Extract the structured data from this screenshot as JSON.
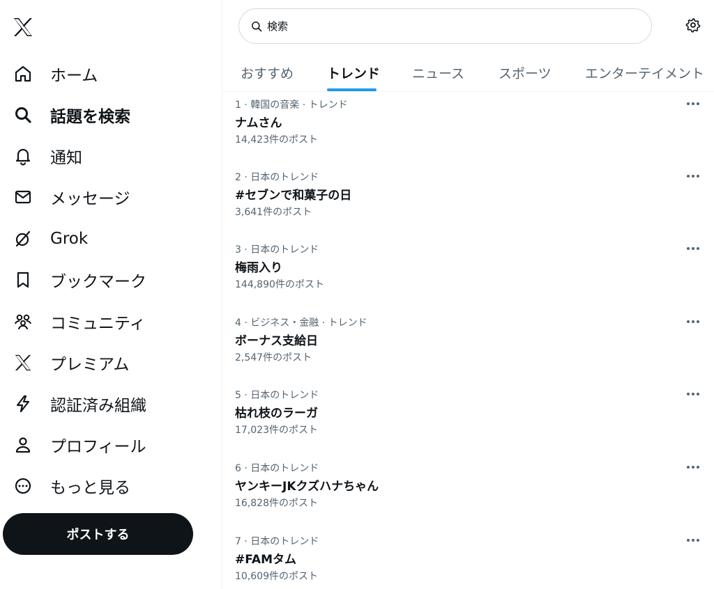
{
  "sidebar": {
    "logo_icon": "x-logo-icon",
    "items": [
      {
        "label": "ホーム",
        "icon": "home-icon"
      },
      {
        "label": "話題を検索",
        "icon": "search-icon",
        "active": true
      },
      {
        "label": "通知",
        "icon": "bell-icon"
      },
      {
        "label": "メッセージ",
        "icon": "mail-icon"
      },
      {
        "label": "Grok",
        "icon": "grok-icon"
      },
      {
        "label": "ブックマーク",
        "icon": "bookmark-icon"
      },
      {
        "label": "コミュニティ",
        "icon": "communities-icon"
      },
      {
        "label": "プレミアム",
        "icon": "x-premium-icon"
      },
      {
        "label": "認証済み組織",
        "icon": "lightning-icon"
      },
      {
        "label": "プロフィール",
        "icon": "profile-icon"
      },
      {
        "label": "もっと見る",
        "icon": "more-circle-icon"
      }
    ],
    "post_button_label": "ポストする"
  },
  "search": {
    "value": "",
    "placeholder": "検索",
    "icon": "search-icon"
  },
  "settings_icon": "gear-icon",
  "tabs": [
    {
      "label": "おすすめ"
    },
    {
      "label": "トレンド",
      "active": true
    },
    {
      "label": "ニュース"
    },
    {
      "label": "スポーツ"
    },
    {
      "label": "エンターテイメント"
    }
  ],
  "trends": [
    {
      "meta": "1 · 韓国の音楽 · トレンド",
      "title": "ナムさん",
      "count": "14,423件のポスト"
    },
    {
      "meta": "2 · 日本のトレンド",
      "title": "#セブンで和菓子の日",
      "count": "3,641件のポスト"
    },
    {
      "meta": "3 · 日本のトレンド",
      "title": "梅雨入り",
      "count": "144,890件のポスト"
    },
    {
      "meta": "4 · ビジネス・金融 · トレンド",
      "title": "ボーナス支給日",
      "count": "2,547件のポスト"
    },
    {
      "meta": "5 · 日本のトレンド",
      "title": "枯れ枝のラーガ",
      "count": "17,023件のポスト"
    },
    {
      "meta": "6 · 日本のトレンド",
      "title": "ヤンキーJKクズハナちゃん",
      "count": "16,828件のポスト"
    },
    {
      "meta": "7 · 日本のトレンド",
      "title": "#FAMタム",
      "count": "10,609件のポスト"
    }
  ],
  "colors": {
    "text": "#0f1419",
    "secondary": "#536471",
    "accent": "#1d9bf0",
    "border": "#eff3f4"
  }
}
